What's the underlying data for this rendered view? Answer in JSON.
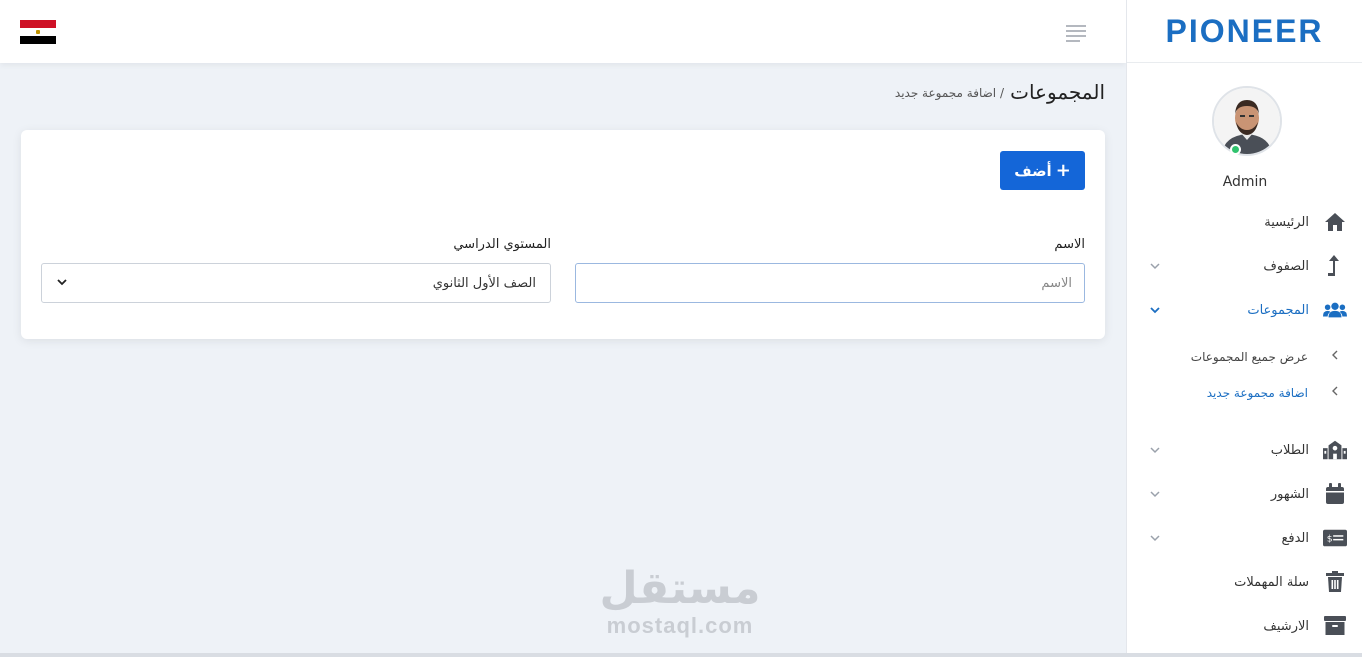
{
  "brand": {
    "name": "PIONEER",
    "accent": "#1b6ec2"
  },
  "header": {
    "flag_colors": [
      "#ce1126",
      "#ffffff",
      "#000000"
    ],
    "menu_icon": "hamburger-icon"
  },
  "user": {
    "name": "Admin",
    "status_color": "#31c36e"
  },
  "sidebar": {
    "items": [
      {
        "label": "الرئيسية",
        "icon": "home-icon"
      },
      {
        "label": "الصفوف",
        "icon": "level-up-icon"
      },
      {
        "label": "المجموعات",
        "icon": "users-icon"
      },
      {
        "label": "الطلاب",
        "icon": "school-icon"
      },
      {
        "label": "الشهور",
        "icon": "calendar-icon"
      },
      {
        "label": "الدفع",
        "icon": "money-check-icon"
      },
      {
        "label": "سلة المهملات",
        "icon": "trash-icon"
      },
      {
        "label": "الارشيف",
        "icon": "archive-icon"
      }
    ],
    "subitems": [
      {
        "label": "عرض جميع المجموعات"
      },
      {
        "label": "اضافة مجموعة جديد"
      }
    ]
  },
  "page": {
    "title": "المجموعات",
    "breadcrumb": "/ اضافة مجموعة جديد"
  },
  "form": {
    "add_button": "أضف",
    "name_label": "الاسم",
    "name_placeholder": "الاسم",
    "level_label": "المستوي الدراسي",
    "level_value": "الصف الأول الثانوي"
  },
  "watermark": {
    "arabic": "مستقل",
    "latin": "mostaql.com"
  }
}
